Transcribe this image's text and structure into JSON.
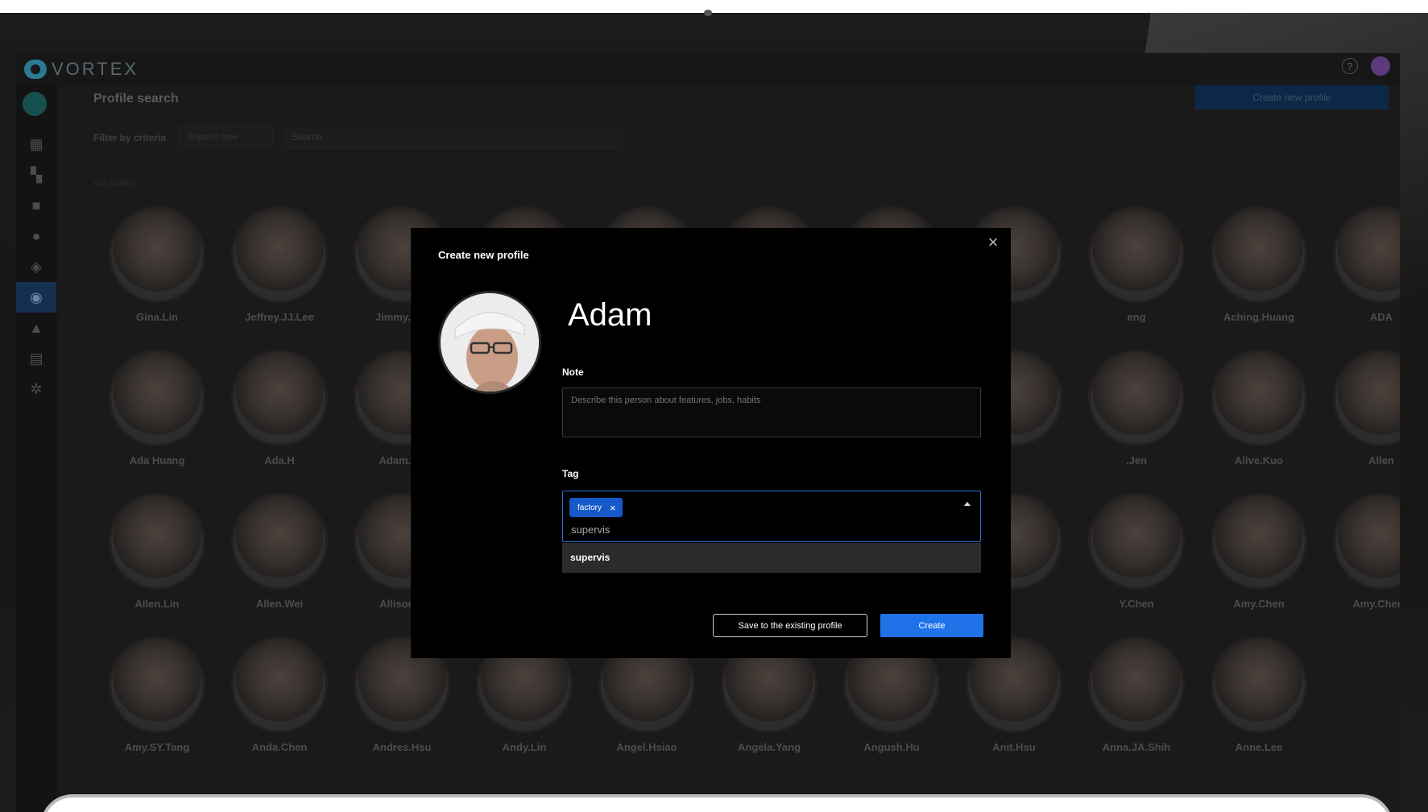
{
  "app": {
    "brand": "VORTEX"
  },
  "header": {
    "page_title": "Profile search",
    "create_button": "Create new profile",
    "help_glyph": "?"
  },
  "filter": {
    "label": "Filter by criteria",
    "select_value": "Support type",
    "search_placeholder": "Search"
  },
  "profiles": {
    "count_text": "404 profiles",
    "names": [
      "Gina.Lin",
      "Jeffrey.JJ.Lee",
      "Jimmy.CC.",
      "",
      "",
      "",
      "",
      "",
      "eng",
      "Aching.Huang",
      "ADA",
      "Ada Huang",
      "Ada.H",
      "Adam.Ch",
      "",
      "",
      "",
      "",
      "",
      ".Jen",
      "Alive.Kuo",
      "Allen",
      "Allen.Lin",
      "Allen.Wei",
      "Allison.V",
      "",
      "",
      "",
      "",
      "",
      "Y.Chen",
      "Amy.Chen",
      "Amy.Cheng",
      "Amy.SY.Tang",
      "Anda.Chen",
      "Andres.Hsu",
      "Andy.Lin",
      "Angel.Hsiao",
      "Angela.Yang",
      "Angush.Hu",
      "Anit.Hsu",
      "Anna.JA.Shih",
      "Anne.Lee"
    ]
  },
  "modal": {
    "title": "Create new profile",
    "close_glyph": "×",
    "profile_name": "Adam",
    "note_label": "Note",
    "note_placeholder": "Describe this person about features, jobs, habits",
    "tag_label": "Tag",
    "tags": [
      {
        "label": "factory",
        "remove_glyph": "×"
      }
    ],
    "tag_input_value": "supervis",
    "suggestion": "supervis",
    "save_button": "Save to the existing profile",
    "create_button": "Create"
  },
  "colors": {
    "accent": "#1f72e8",
    "chip": "#1558c7",
    "modal_bg": "#000000"
  },
  "sidebar_icons": [
    "dashboard-icon",
    "grid-edit-icon",
    "camera-icon",
    "person-icon",
    "tag-icon",
    "profile-icon",
    "bell-icon",
    "archive-icon",
    "gear-icon"
  ]
}
